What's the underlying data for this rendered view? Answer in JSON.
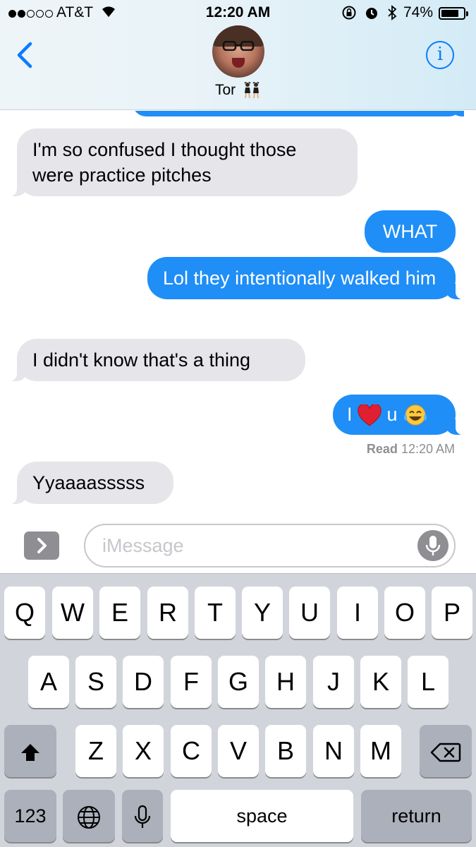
{
  "status_bar": {
    "carrier": "AT&T",
    "time": "12:20 AM",
    "battery_percent": "74%",
    "battery_level": 0.74,
    "signal_bars_filled": 2,
    "signal_bars_total": 5,
    "icons": [
      "wifi-icon",
      "rotation-lock-icon",
      "alarm-icon",
      "bluetooth-icon",
      "battery-icon"
    ]
  },
  "nav": {
    "back_icon": "chevron-left-icon",
    "contact_name": "Tor",
    "contact_emoji": "dancers-emoji",
    "info_label": "i",
    "accent_color": "#0a7cff"
  },
  "messages": [
    {
      "direction": "incoming",
      "text": "I'm so confused I thought those were practice pitches"
    },
    {
      "direction": "outgoing",
      "text": "WHAT"
    },
    {
      "direction": "outgoing",
      "text": "Lol they intentionally walked him"
    },
    {
      "direction": "incoming",
      "text": "I didn't know that's a thing"
    },
    {
      "direction": "outgoing",
      "text_parts": [
        "I",
        "u"
      ],
      "emojis": [
        "red-heart-emoji",
        "tears-of-joy-emoji"
      ]
    },
    {
      "direction": "incoming",
      "text": "Yyaaaasssss"
    }
  ],
  "receipt": {
    "label": "Read",
    "time": "12:20 AM"
  },
  "colors": {
    "incoming_bubble": "#e5e5ea",
    "outgoing_bubble": "#1f8ef7"
  },
  "composer": {
    "placeholder": "iMessage",
    "expand_icon": "chevron-right-icon",
    "mic_icon": "microphone-icon"
  },
  "keyboard": {
    "row1": [
      "Q",
      "W",
      "E",
      "R",
      "T",
      "Y",
      "U",
      "I",
      "O",
      "P"
    ],
    "row2": [
      "A",
      "S",
      "D",
      "F",
      "G",
      "H",
      "J",
      "K",
      "L"
    ],
    "row3": [
      "Z",
      "X",
      "C",
      "V",
      "B",
      "N",
      "M"
    ],
    "numbers_label": "123",
    "space_label": "space",
    "return_label": "return",
    "shift_icon": "shift-icon",
    "delete_icon": "delete-icon",
    "globe_icon": "globe-icon",
    "dictation_icon": "microphone-icon"
  }
}
